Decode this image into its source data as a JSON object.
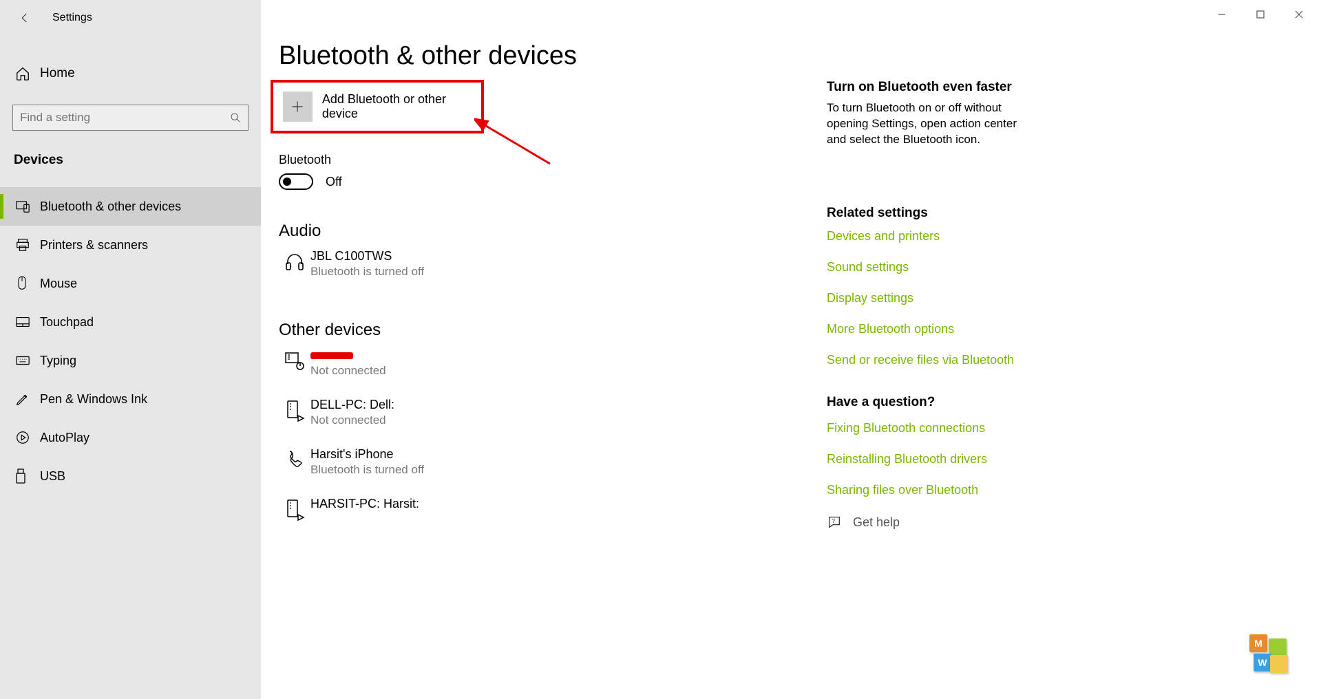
{
  "window": {
    "title": "Settings"
  },
  "sidebar": {
    "home_label": "Home",
    "search_placeholder": "Find a setting",
    "category_label": "Devices",
    "items": [
      {
        "label": "Bluetooth & other devices",
        "active": true
      },
      {
        "label": "Printers & scanners"
      },
      {
        "label": "Mouse"
      },
      {
        "label": "Touchpad"
      },
      {
        "label": "Typing"
      },
      {
        "label": "Pen & Windows Ink"
      },
      {
        "label": "AutoPlay"
      },
      {
        "label": "USB"
      }
    ]
  },
  "main": {
    "page_title": "Bluetooth & other devices",
    "add_label": "Add Bluetooth or other device",
    "bluetooth_label": "Bluetooth",
    "toggle_state": "Off",
    "audio_heading": "Audio",
    "audio_devices": [
      {
        "name": "JBL C100TWS",
        "sub": "Bluetooth is turned off"
      }
    ],
    "other_heading": "Other devices",
    "other_devices": [
      {
        "name": "",
        "sub": "Not connected",
        "redacted": true
      },
      {
        "name": "DELL-PC: Dell:",
        "sub": "Not connected"
      },
      {
        "name": "Harsit's iPhone",
        "sub": "Bluetooth is turned off"
      },
      {
        "name": "HARSIT-PC: Harsit:",
        "sub": ""
      }
    ]
  },
  "right": {
    "tip_title": "Turn on Bluetooth even faster",
    "tip_body": "To turn Bluetooth on or off without opening Settings, open action center and select the Bluetooth icon.",
    "related_title": "Related settings",
    "links": [
      "Devices and printers",
      "Sound settings",
      "Display settings",
      "More Bluetooth options",
      "Send or receive files via Bluetooth"
    ],
    "question_title": "Have a question?",
    "question_links": [
      "Fixing Bluetooth connections",
      "Reinstalling Bluetooth drivers",
      "Sharing files over Bluetooth"
    ],
    "get_help": "Get help"
  },
  "colors": {
    "accent": "#7bb700",
    "annotation": "#e60000"
  }
}
